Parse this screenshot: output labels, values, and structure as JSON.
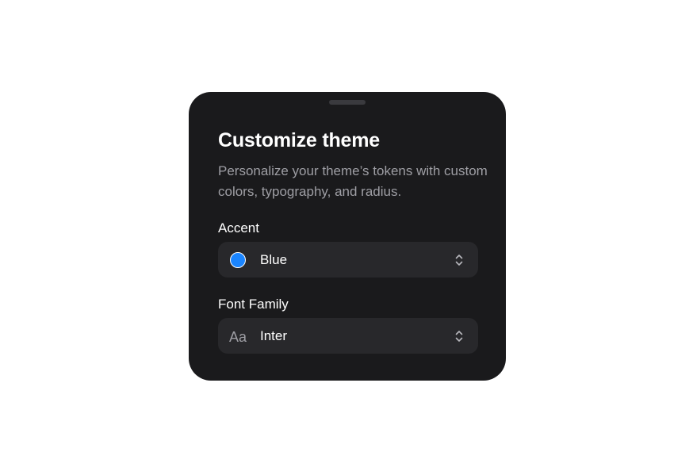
{
  "sheet": {
    "title": "Customize theme",
    "description": "Personalize your theme’s tokens with custom colors, typography, and radius."
  },
  "accent": {
    "label": "Accent",
    "value": "Blue",
    "swatch_color": "#1a85ff",
    "chevron_icon": "chevron-up-down-icon"
  },
  "font_family": {
    "label": "Font Family",
    "value": "Inter",
    "icon": "text-aa-icon",
    "icon_glyph": "Aa",
    "chevron_icon": "chevron-up-down-icon"
  },
  "colors": {
    "sheet_background": "#1a1a1c",
    "select_background": "#28282b",
    "text_primary": "#ffffff",
    "text_secondary": "#9e9ea4"
  }
}
